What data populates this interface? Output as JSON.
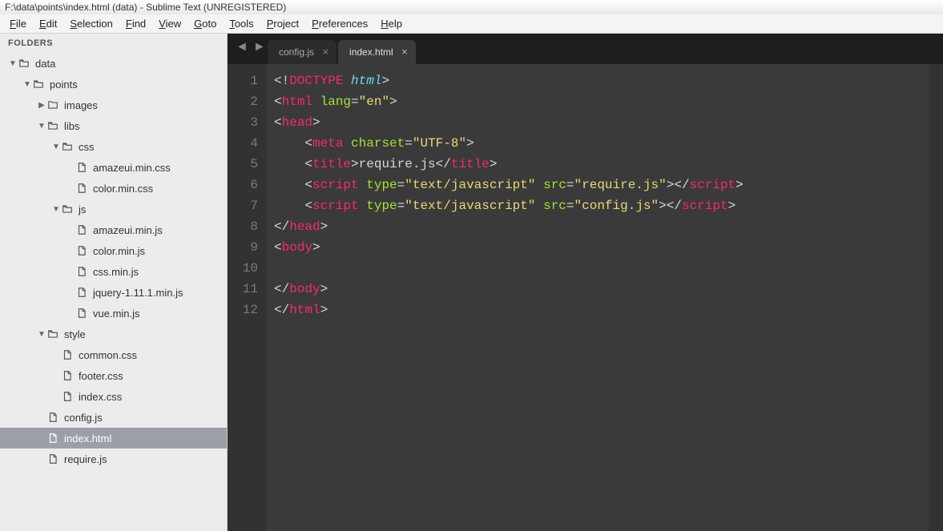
{
  "window": {
    "title": "F:\\data\\points\\index.html (data) - Sublime Text (UNREGISTERED)"
  },
  "menu": {
    "file": "File",
    "edit": "Edit",
    "selection": "Selection",
    "find": "Find",
    "view": "View",
    "goto": "Goto",
    "tools": "Tools",
    "project": "Project",
    "preferences": "Preferences",
    "help": "Help"
  },
  "sidebar": {
    "header": "FOLDERS",
    "tree": [
      {
        "name": "data",
        "type": "folder",
        "open": true,
        "depth": 0,
        "children": [
          {
            "name": "points",
            "type": "folder",
            "open": true,
            "depth": 1,
            "children": [
              {
                "name": "images",
                "type": "folder",
                "open": false,
                "depth": 2
              },
              {
                "name": "libs",
                "type": "folder",
                "open": true,
                "depth": 2,
                "children": [
                  {
                    "name": "css",
                    "type": "folder",
                    "open": true,
                    "depth": 3,
                    "children": [
                      {
                        "name": "amazeui.min.css",
                        "type": "file",
                        "depth": 4
                      },
                      {
                        "name": "color.min.css",
                        "type": "file",
                        "depth": 4
                      }
                    ]
                  },
                  {
                    "name": "js",
                    "type": "folder",
                    "open": true,
                    "depth": 3,
                    "children": [
                      {
                        "name": "amazeui.min.js",
                        "type": "file",
                        "depth": 4
                      },
                      {
                        "name": "color.min.js",
                        "type": "file",
                        "depth": 4
                      },
                      {
                        "name": "css.min.js",
                        "type": "file",
                        "depth": 4
                      },
                      {
                        "name": "jquery-1.11.1.min.js",
                        "type": "file",
                        "depth": 4
                      },
                      {
                        "name": "vue.min.js",
                        "type": "file",
                        "depth": 4
                      }
                    ]
                  }
                ]
              },
              {
                "name": "style",
                "type": "folder",
                "open": true,
                "depth": 2,
                "children": [
                  {
                    "name": "common.css",
                    "type": "file",
                    "depth": 3
                  },
                  {
                    "name": "footer.css",
                    "type": "file",
                    "depth": 3
                  },
                  {
                    "name": "index.css",
                    "type": "file",
                    "depth": 3
                  }
                ]
              },
              {
                "name": "config.js",
                "type": "file",
                "depth": 2
              },
              {
                "name": "index.html",
                "type": "file",
                "depth": 2,
                "selected": true
              },
              {
                "name": "require.js",
                "type": "file",
                "depth": 2
              }
            ]
          }
        ]
      }
    ]
  },
  "tabs": [
    {
      "label": "config.js",
      "active": false
    },
    {
      "label": "index.html",
      "active": true
    }
  ],
  "code": {
    "line_count": 12,
    "lines": [
      [
        {
          "c": "p",
          "t": "<!"
        },
        {
          "c": "t",
          "t": "DOCTYPE"
        },
        {
          "c": "p",
          "t": " "
        },
        {
          "c": "d",
          "t": "html"
        },
        {
          "c": "p",
          "t": ">"
        }
      ],
      [
        {
          "c": "p",
          "t": "<"
        },
        {
          "c": "t",
          "t": "html"
        },
        {
          "c": "p",
          "t": " "
        },
        {
          "c": "a",
          "t": "lang"
        },
        {
          "c": "p",
          "t": "="
        },
        {
          "c": "s",
          "t": "\"en\""
        },
        {
          "c": "p",
          "t": ">"
        }
      ],
      [
        {
          "c": "p",
          "t": "<"
        },
        {
          "c": "t",
          "t": "head"
        },
        {
          "c": "p",
          "t": ">"
        }
      ],
      [
        {
          "c": "p",
          "t": "    <"
        },
        {
          "c": "t",
          "t": "meta"
        },
        {
          "c": "p",
          "t": " "
        },
        {
          "c": "a",
          "t": "charset"
        },
        {
          "c": "p",
          "t": "="
        },
        {
          "c": "s",
          "t": "\"UTF-8\""
        },
        {
          "c": "p",
          "t": ">"
        }
      ],
      [
        {
          "c": "p",
          "t": "    <"
        },
        {
          "c": "t",
          "t": "title"
        },
        {
          "c": "p",
          "t": ">require.js</"
        },
        {
          "c": "t",
          "t": "title"
        },
        {
          "c": "p",
          "t": ">"
        }
      ],
      [
        {
          "c": "p",
          "t": "    <"
        },
        {
          "c": "t",
          "t": "script"
        },
        {
          "c": "p",
          "t": " "
        },
        {
          "c": "a",
          "t": "type"
        },
        {
          "c": "p",
          "t": "="
        },
        {
          "c": "s",
          "t": "\"text/javascript\""
        },
        {
          "c": "p",
          "t": " "
        },
        {
          "c": "a",
          "t": "src"
        },
        {
          "c": "p",
          "t": "="
        },
        {
          "c": "s",
          "t": "\"require.js\""
        },
        {
          "c": "p",
          "t": "></"
        },
        {
          "c": "t",
          "t": "script"
        },
        {
          "c": "p",
          "t": ">"
        }
      ],
      [
        {
          "c": "p",
          "t": "    <"
        },
        {
          "c": "t",
          "t": "script"
        },
        {
          "c": "p",
          "t": " "
        },
        {
          "c": "a",
          "t": "type"
        },
        {
          "c": "p",
          "t": "="
        },
        {
          "c": "s",
          "t": "\"text/javascript\""
        },
        {
          "c": "p",
          "t": " "
        },
        {
          "c": "a",
          "t": "src"
        },
        {
          "c": "p",
          "t": "="
        },
        {
          "c": "s",
          "t": "\"config.js\""
        },
        {
          "c": "p",
          "t": "></"
        },
        {
          "c": "t",
          "t": "script"
        },
        {
          "c": "p",
          "t": ">"
        }
      ],
      [
        {
          "c": "p",
          "t": "</"
        },
        {
          "c": "t",
          "t": "head"
        },
        {
          "c": "p",
          "t": ">"
        }
      ],
      [
        {
          "c": "p",
          "t": "<"
        },
        {
          "c": "t",
          "t": "body"
        },
        {
          "c": "p",
          "t": ">"
        }
      ],
      [],
      [
        {
          "c": "p",
          "t": "</"
        },
        {
          "c": "t",
          "t": "body"
        },
        {
          "c": "p",
          "t": ">"
        }
      ],
      [
        {
          "c": "p",
          "t": "</"
        },
        {
          "c": "t",
          "t": "html"
        },
        {
          "c": "p",
          "t": ">"
        }
      ]
    ]
  }
}
